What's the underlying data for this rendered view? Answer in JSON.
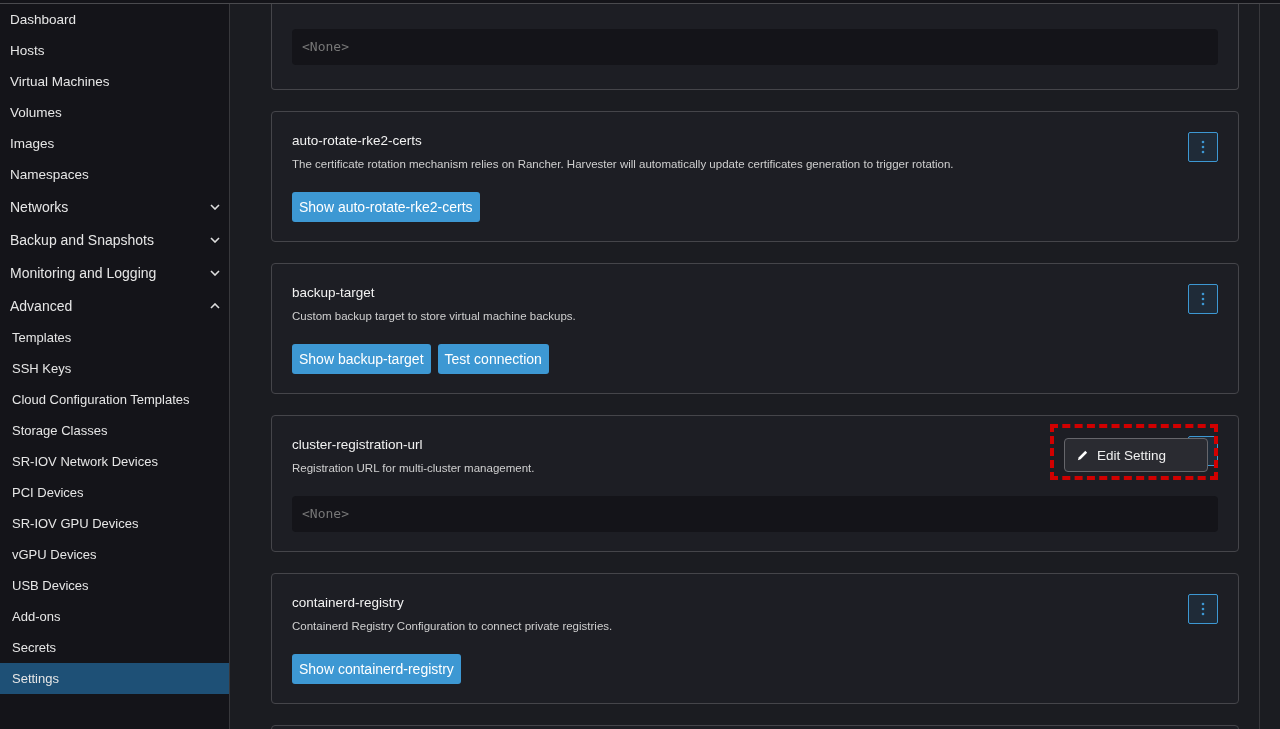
{
  "sidebar": {
    "items": [
      {
        "label": "Dashboard",
        "kind": "link",
        "selected": false
      },
      {
        "label": "Hosts",
        "kind": "link",
        "selected": false
      },
      {
        "label": "Virtual Machines",
        "kind": "link",
        "selected": false
      },
      {
        "label": "Volumes",
        "kind": "link",
        "selected": false
      },
      {
        "label": "Images",
        "kind": "link",
        "selected": false
      },
      {
        "label": "Namespaces",
        "kind": "link",
        "selected": false
      },
      {
        "label": "Networks",
        "kind": "group",
        "expanded": false,
        "selected": false
      },
      {
        "label": "Backup and Snapshots",
        "kind": "group",
        "expanded": false,
        "selected": false
      },
      {
        "label": "Monitoring and Logging",
        "kind": "group",
        "expanded": false,
        "selected": false
      },
      {
        "label": "Advanced",
        "kind": "group",
        "expanded": true,
        "selected": false,
        "children": [
          {
            "label": "Templates",
            "selected": false
          },
          {
            "label": "SSH Keys",
            "selected": false
          },
          {
            "label": "Cloud Configuration Templates",
            "selected": false
          },
          {
            "label": "Storage Classes",
            "selected": false
          },
          {
            "label": "SR-IOV Network Devices",
            "selected": false
          },
          {
            "label": "PCI Devices",
            "selected": false
          },
          {
            "label": "SR-IOV GPU Devices",
            "selected": false
          },
          {
            "label": "vGPU Devices",
            "selected": false
          },
          {
            "label": "USB Devices",
            "selected": false
          },
          {
            "label": "Add-ons",
            "selected": false
          },
          {
            "label": "Secrets",
            "selected": false
          },
          {
            "label": "Settings",
            "selected": true
          }
        ]
      }
    ]
  },
  "settings": [
    {
      "kind": "partial",
      "value": "<None>"
    },
    {
      "kind": "buttons",
      "name": "auto-rotate-rke2-certs",
      "description": "The certificate rotation mechanism relies on Rancher. Harvester will automatically update certificates generation to trigger rotation.",
      "buttons": [
        "Show auto-rotate-rke2-certs"
      ],
      "menu_open": false
    },
    {
      "kind": "buttons",
      "name": "backup-target",
      "description": "Custom backup target to store virtual machine backups.",
      "buttons": [
        "Show backup-target",
        "Test connection"
      ],
      "menu_open": false
    },
    {
      "kind": "value",
      "name": "cluster-registration-url",
      "description": "Registration URL for multi-cluster management.",
      "value": "<None>",
      "menu_open": true
    },
    {
      "kind": "buttons",
      "name": "containerd-registry",
      "description": "Containerd Registry Configuration to connect private registries.",
      "buttons": [
        "Show containerd-registry"
      ],
      "menu_open": false
    },
    {
      "kind": "cut"
    }
  ],
  "context_menu": {
    "items": [
      {
        "label": "Edit Setting"
      }
    ],
    "highlighted": true
  }
}
